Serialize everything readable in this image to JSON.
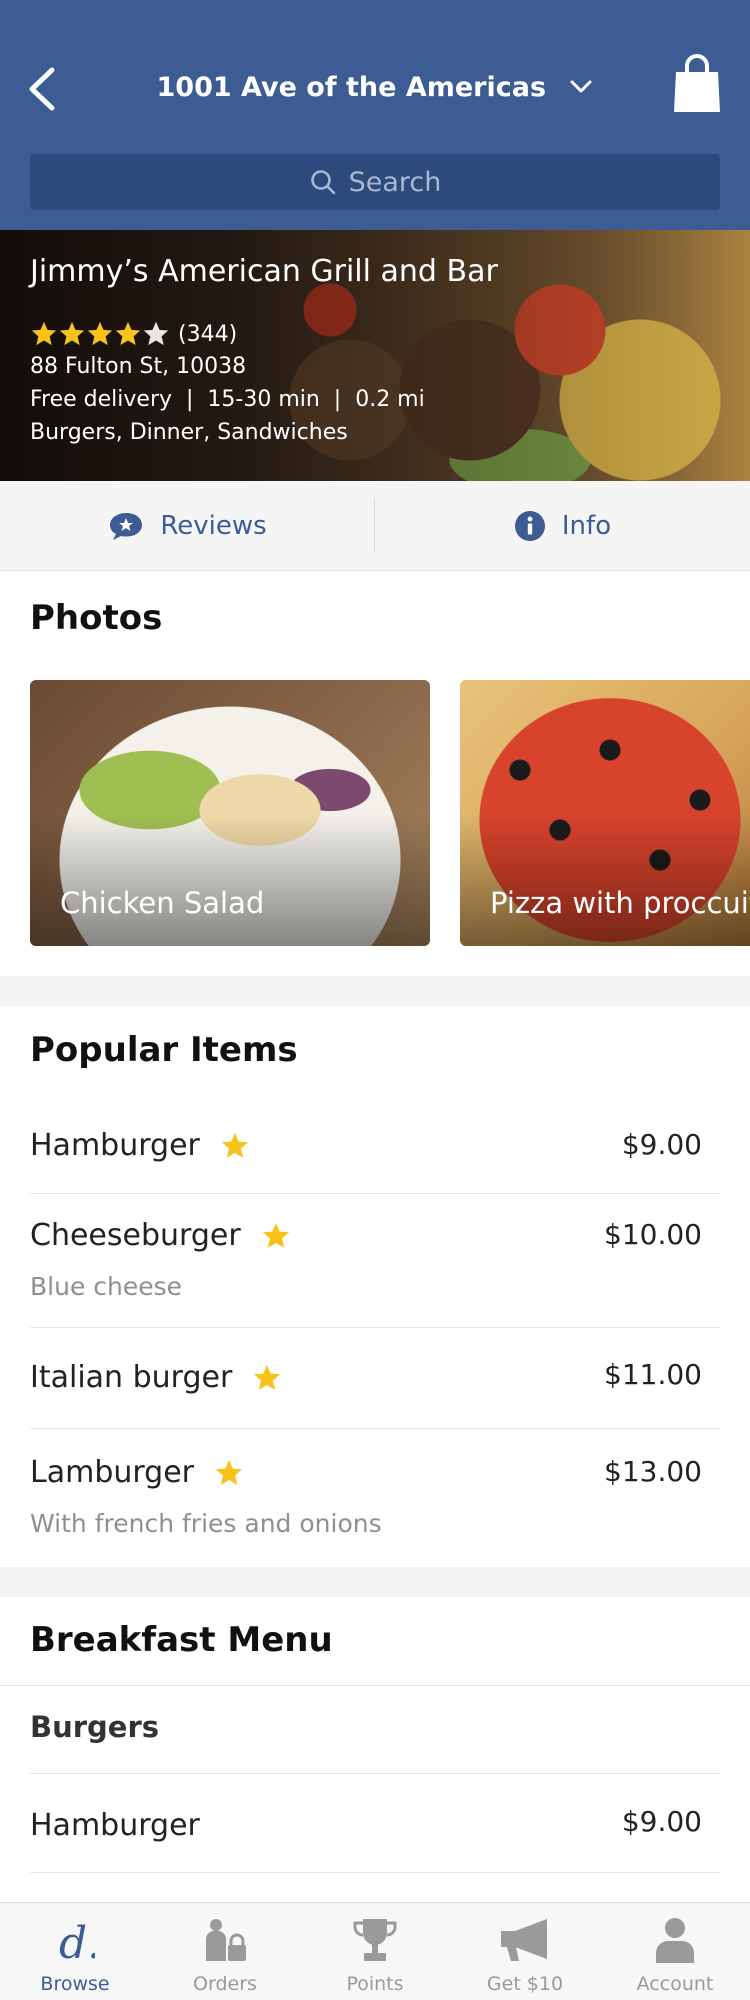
{
  "header": {
    "address": "1001 Ave of the Americas",
    "search_placeholder": "Search"
  },
  "restaurant": {
    "name": "Jimmy’s American Grill and Bar",
    "rating_stars": 4,
    "rating_max": 5,
    "review_count": "(344)",
    "address": "88 Fulton St, 10038",
    "delivery": "Free delivery  |  15-30 min  |  0.2 mi",
    "categories": "Burgers, Dinner, Sandwiches"
  },
  "tabs": [
    {
      "label": "Reviews",
      "icon": "chat-star-icon"
    },
    {
      "label": "Info",
      "icon": "info-icon"
    }
  ],
  "photos": {
    "title": "Photos",
    "items": [
      {
        "caption": "Chicken Salad"
      },
      {
        "caption": "Pizza with proccuito"
      }
    ]
  },
  "popular": {
    "title": "Popular Items",
    "items": [
      {
        "name": "Hamburger",
        "price": "$9.00",
        "description": "",
        "featured": true
      },
      {
        "name": "Cheeseburger",
        "price": "$10.00",
        "description": "Blue cheese",
        "featured": true
      },
      {
        "name": "Italian burger",
        "price": "$11.00",
        "description": "",
        "featured": true
      },
      {
        "name": "Lamburger",
        "price": "$13.00",
        "description": "With french fries and onions",
        "featured": true
      }
    ]
  },
  "breakfast": {
    "title": "Breakfast Menu",
    "subsection": "Burgers",
    "items": [
      {
        "name": "Hamburger",
        "price": "$9.00"
      }
    ]
  },
  "bottom_nav": [
    {
      "label": "Browse",
      "icon": "browse-d-icon",
      "active": true
    },
    {
      "label": "Orders",
      "icon": "orders-icon",
      "active": false
    },
    {
      "label": "Points",
      "icon": "trophy-icon",
      "active": false
    },
    {
      "label": "Get $10",
      "icon": "megaphone-icon",
      "active": false
    },
    {
      "label": "Account",
      "icon": "person-icon",
      "active": false
    }
  ],
  "colors": {
    "brand": "#3d5c94",
    "star": "#f7c31a",
    "muted": "#8f8f8f"
  }
}
